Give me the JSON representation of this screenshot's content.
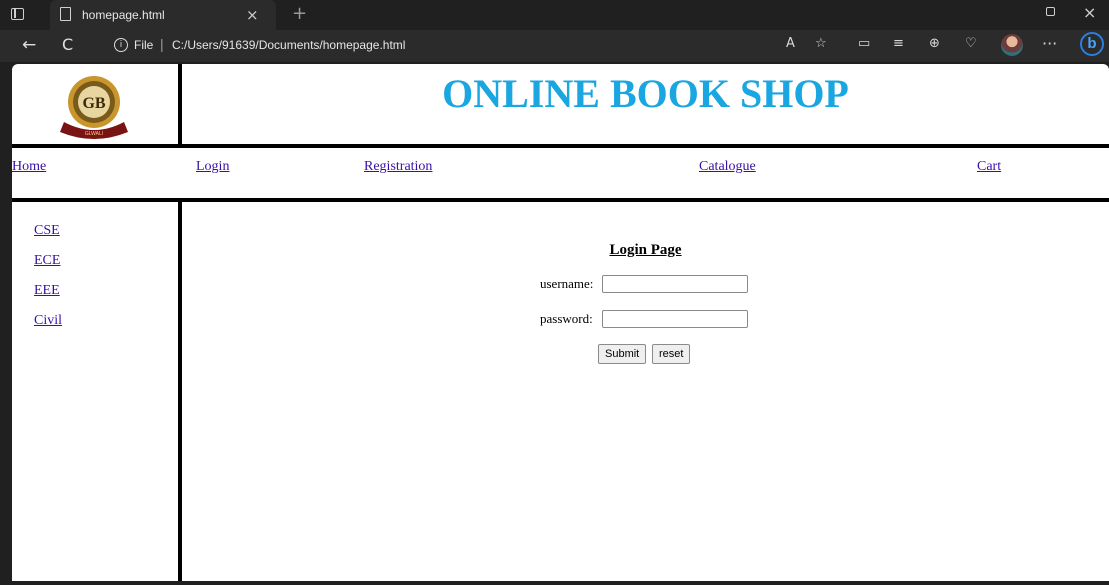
{
  "browser": {
    "tab_title": "homepage.html",
    "tab_close": "×",
    "new_tab": "+",
    "window_close": "×",
    "nav_back": "←",
    "nav_refresh": "C",
    "info_icon": "i",
    "file_label": "File",
    "url_separator": "|",
    "url": "C:/Users/91639/Documents/homepage.html",
    "more": "···",
    "bing": "b"
  },
  "site": {
    "title": "ONLINE BOOK SHOP",
    "logo_text": "GLWALI"
  },
  "nav": {
    "items": [
      {
        "label": "Home"
      },
      {
        "label": "Login"
      },
      {
        "label": "Registration"
      },
      {
        "label": "Catalogue"
      },
      {
        "label": "Cart"
      }
    ]
  },
  "sidebar": {
    "items": [
      {
        "label": "CSE"
      },
      {
        "label": "ECE"
      },
      {
        "label": "EEE"
      },
      {
        "label": "Civil"
      }
    ]
  },
  "login": {
    "title": "Login Page",
    "username_label": "username:",
    "username_value": "",
    "password_label": "password:",
    "password_value": "",
    "submit_label": "Submit",
    "reset_label": "reset"
  },
  "colors": {
    "title": "#1aa6e0",
    "link": "#3a0ea8",
    "chrome_bg": "#202020"
  }
}
